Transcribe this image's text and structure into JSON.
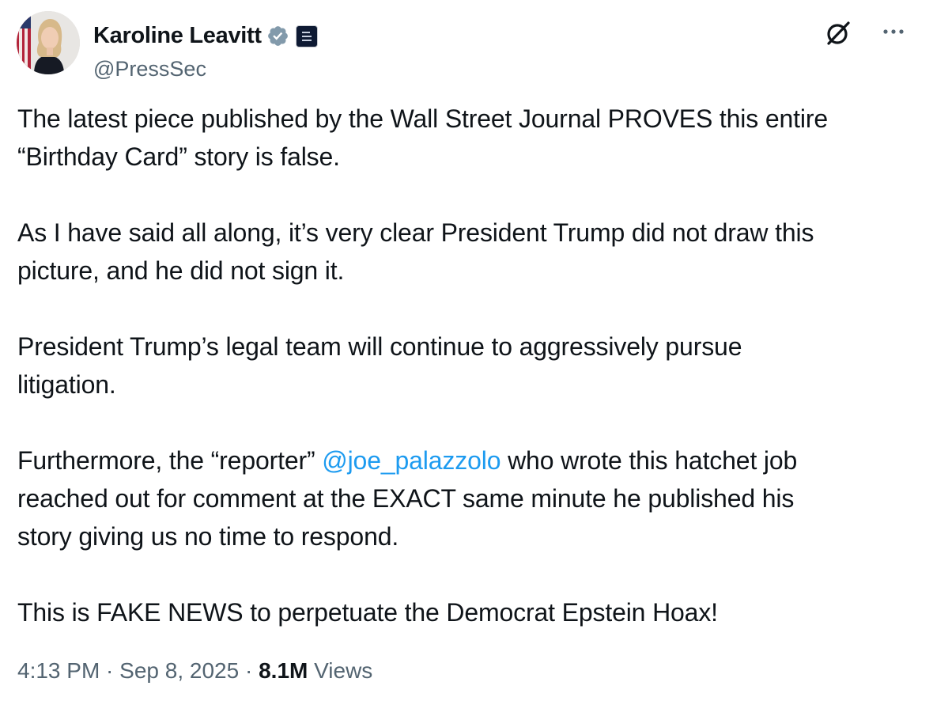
{
  "author": {
    "display_name": "Karoline Leavitt",
    "handle": "@PressSec",
    "verified_icon": "verified-badge-icon",
    "affiliation_icon": "white-house-badge-icon",
    "avatar": "profile-photo"
  },
  "actions": {
    "grok_icon": "grok-icon",
    "more_icon": "more-options-icon"
  },
  "tweet": {
    "p1": "The latest piece published by the Wall Street Journal PROVES this entire\n“Birthday Card” story is false.",
    "p2": "As I have said all along, it’s very clear President Trump did not draw this\npicture, and he did not sign it.",
    "p3": "President Trump’s legal team will continue to aggressively pursue\nlitigation.",
    "p4_before": "Furthermore, the “reporter” ",
    "p4_mention": "@joe_palazzolo",
    "p4_after": " who wrote this hatchet job\nreached out for comment at the EXACT same minute he published his\nstory giving us no time to respond.",
    "p5": "This is FAKE NEWS to perpetuate the Democrat Epstein Hoax!"
  },
  "meta": {
    "time": "4:13 PM",
    "separator": " · ",
    "date": "Sep 8, 2025",
    "views_count": "8.1M",
    "views_label": " Views"
  },
  "colors": {
    "text": "#0f1419",
    "secondary": "#536471",
    "link": "#1d9bf0"
  }
}
